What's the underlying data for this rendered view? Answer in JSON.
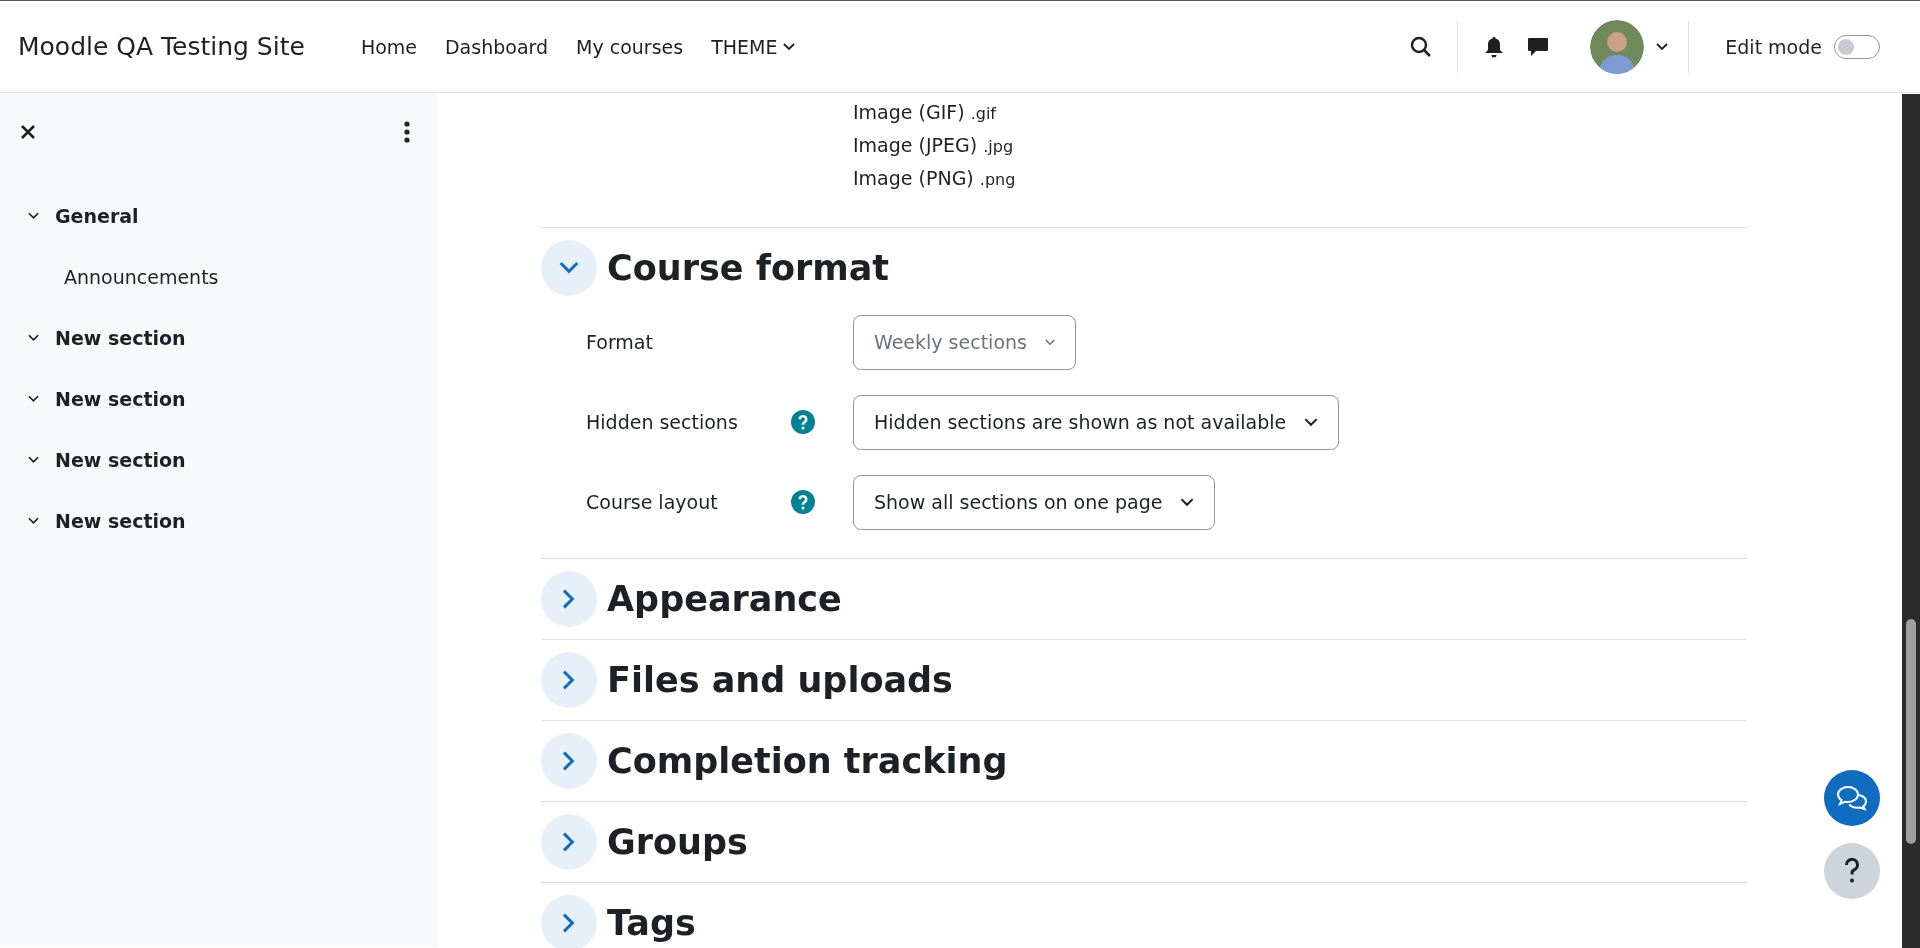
{
  "header": {
    "site_name": "Moodle QA Testing Site",
    "nav": [
      {
        "label": "Home",
        "dropdown": false
      },
      {
        "label": "Dashboard",
        "dropdown": false
      },
      {
        "label": "My courses",
        "dropdown": false
      },
      {
        "label": "THEME",
        "dropdown": true
      }
    ],
    "edit_mode": {
      "label": "Edit mode",
      "on": false
    }
  },
  "sidebar": {
    "items": [
      {
        "label": "General",
        "expanded": true,
        "children": [
          {
            "label": "Announcements"
          }
        ]
      },
      {
        "label": "New section",
        "expanded": true
      },
      {
        "label": "New section",
        "expanded": true
      },
      {
        "label": "New section",
        "expanded": true
      },
      {
        "label": "New section",
        "expanded": true
      }
    ]
  },
  "file_types": [
    {
      "name": "Image (GIF)",
      "ext": ".gif"
    },
    {
      "name": "Image (JPEG)",
      "ext": ".jpg"
    },
    {
      "name": "Image (PNG)",
      "ext": ".png"
    }
  ],
  "sections": [
    {
      "title": "Course format",
      "expanded": true,
      "fields": [
        {
          "label": "Format",
          "help": false,
          "value": "Weekly sections",
          "disabled": true
        },
        {
          "label": "Hidden sections",
          "help": true,
          "value": "Hidden sections are shown as not available",
          "disabled": false
        },
        {
          "label": "Course layout",
          "help": true,
          "value": "Show all sections on one page",
          "disabled": false
        }
      ]
    },
    {
      "title": "Appearance",
      "expanded": false
    },
    {
      "title": "Files and uploads",
      "expanded": false
    },
    {
      "title": "Completion tracking",
      "expanded": false
    },
    {
      "title": "Groups",
      "expanded": false
    },
    {
      "title": "Tags",
      "expanded": false
    }
  ]
}
